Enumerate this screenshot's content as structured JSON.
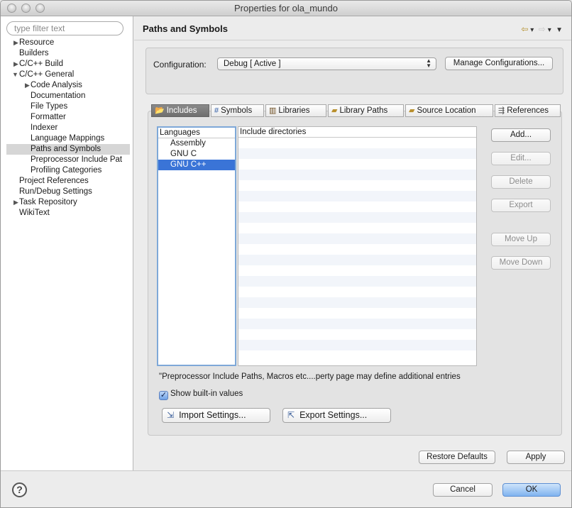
{
  "window": {
    "title": "Properties for ola_mundo"
  },
  "sidebar": {
    "filter_placeholder": "type filter text",
    "items": [
      {
        "label": "Resource",
        "expander": "▶"
      },
      {
        "label": "Builders",
        "expander": ""
      },
      {
        "label": "C/C++ Build",
        "expander": "▶"
      },
      {
        "label": "C/C++ General",
        "expander": "▼"
      },
      {
        "label": "Code Analysis",
        "expander": "▶"
      },
      {
        "label": "Documentation",
        "expander": ""
      },
      {
        "label": "File Types",
        "expander": ""
      },
      {
        "label": "Formatter",
        "expander": ""
      },
      {
        "label": "Indexer",
        "expander": ""
      },
      {
        "label": "Language Mappings",
        "expander": ""
      },
      {
        "label": "Paths and Symbols",
        "expander": "",
        "selected": true
      },
      {
        "label": "Preprocessor Include Pat",
        "expander": ""
      },
      {
        "label": "Profiling Categories",
        "expander": ""
      },
      {
        "label": "Project References",
        "expander": ""
      },
      {
        "label": "Run/Debug Settings",
        "expander": ""
      },
      {
        "label": "Task Repository",
        "expander": "▶"
      },
      {
        "label": "WikiText",
        "expander": ""
      }
    ]
  },
  "header": {
    "title": "Paths and Symbols"
  },
  "configuration": {
    "label": "Configuration:",
    "selected": "Debug  [ Active ]",
    "manage_label": "Manage Configurations..."
  },
  "tabs": [
    {
      "label": "Includes",
      "icon": "includes-icon",
      "active": true
    },
    {
      "label": "Symbols",
      "icon": "hash-icon"
    },
    {
      "label": "Libraries",
      "icon": "library-icon"
    },
    {
      "label": "Library Paths",
      "icon": "folder-icon"
    },
    {
      "label": "Source Location",
      "icon": "folder-icon"
    },
    {
      "label": "References",
      "icon": "reference-icon"
    }
  ],
  "languages": {
    "header": "Languages",
    "items": [
      "Assembly",
      "GNU C",
      "GNU C++"
    ],
    "selected": "GNU C++"
  },
  "includes": {
    "header": "Include directories"
  },
  "buttons": {
    "add": "Add...",
    "edit": "Edit...",
    "delete": "Delete",
    "export": "Export",
    "move_up": "Move Up",
    "move_down": "Move Down"
  },
  "note": "\"Preprocessor Include Paths, Macros etc....perty page may define additional entries",
  "show_builtin": {
    "label": "Show built-in values",
    "checked": true
  },
  "import_settings": "Import Settings...",
  "export_settings": "Export Settings...",
  "restore_defaults": "Restore Defaults",
  "apply": "Apply",
  "cancel": "Cancel",
  "ok": "OK",
  "colors": {
    "selection": "#3a74d7",
    "list_focus_border": "#7ea8d8",
    "default_button": "#7fb3ef"
  }
}
